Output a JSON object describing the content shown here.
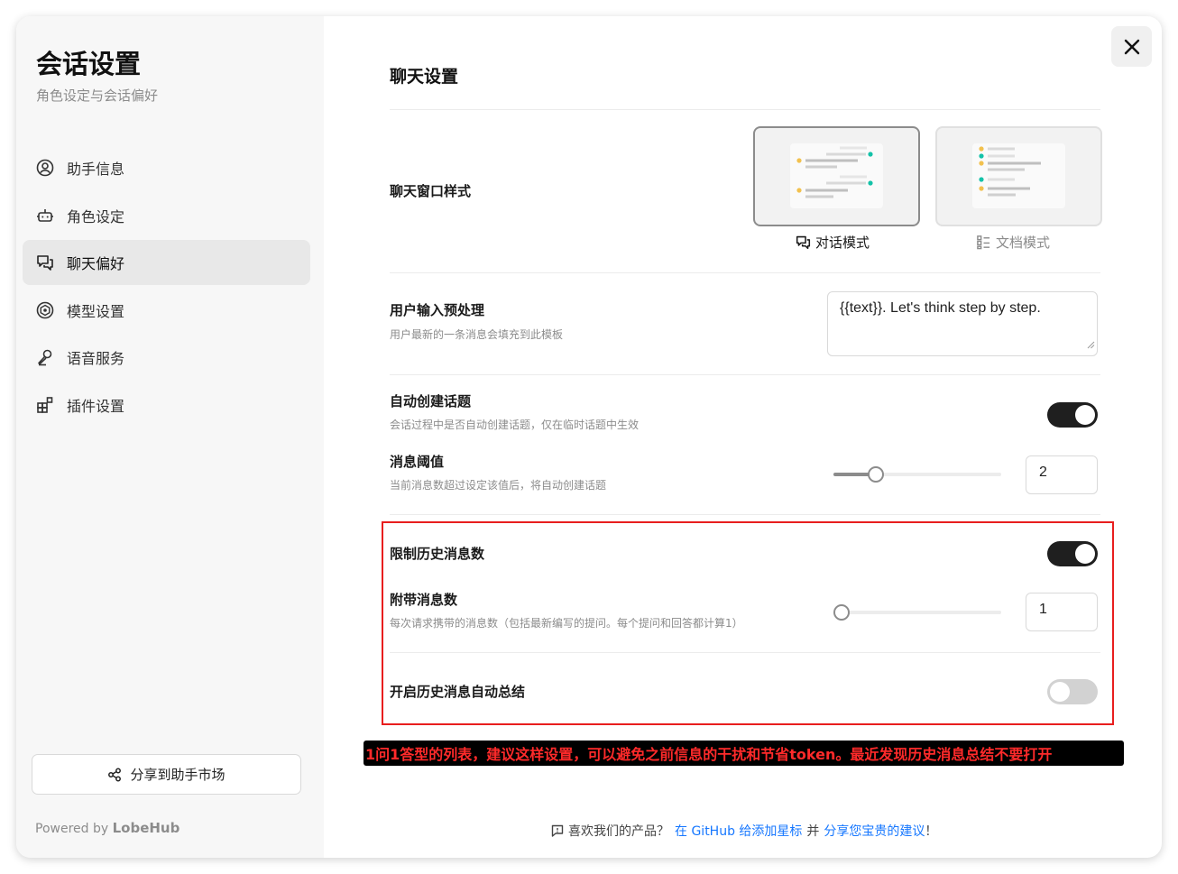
{
  "sidebar": {
    "title": "会话设置",
    "subtitle": "角色设定与会话偏好",
    "items": [
      {
        "label": "助手信息",
        "icon": "user-circle-icon"
      },
      {
        "label": "角色设定",
        "icon": "bot-icon"
      },
      {
        "label": "聊天偏好",
        "icon": "chat-bubbles-icon",
        "active": true
      },
      {
        "label": "模型设置",
        "icon": "model-icon"
      },
      {
        "label": "语音服务",
        "icon": "mic-icon"
      },
      {
        "label": "插件设置",
        "icon": "plugin-blocks-icon"
      }
    ],
    "share_label": "分享到助手市场",
    "powered_prefix": "Powered by",
    "powered_brand": "LobeHub"
  },
  "main": {
    "title": "聊天设置",
    "chat_style": {
      "label": "聊天窗口样式",
      "options": [
        {
          "label": "对话模式",
          "selected": true
        },
        {
          "label": "文档模式",
          "selected": false
        }
      ]
    },
    "input_template": {
      "label": "用户输入预处理",
      "desc": "用户最新的一条消息会填充到此模板",
      "value": "{{text}}. Let's think step by step."
    },
    "auto_topic": {
      "label": "自动创建话题",
      "desc": "会话过程中是否自动创建话题，仅在临时话题中生效",
      "enabled": true
    },
    "msg_threshold": {
      "label": "消息阈值",
      "desc": "当前消息数超过设定该值后，将自动创建话题",
      "value": "2",
      "slider_fraction": 0.25
    },
    "limit_history": {
      "label": "限制历史消息数",
      "enabled": true
    },
    "attached_msgs": {
      "label": "附带消息数",
      "desc": "每次请求携带的消息数（包括最新编写的提问。每个提问和回答都计算1）",
      "value": "1",
      "slider_fraction": 0.0
    },
    "history_summary": {
      "label": "开启历史消息自动总结",
      "enabled": false
    }
  },
  "annotation": "1问1答型的列表，建议这样设置，可以避免之前信息的干扰和节省token。最近发现历史消息总结不要打开",
  "footer": {
    "prefix": "喜欢我们的产品？",
    "link1": "在 GitHub 给添加星标",
    "mid": "并",
    "link2": "分享您宝贵的建议",
    "suffix": "！"
  },
  "colors": {
    "accent_dark": "#1f1f1f",
    "link": "#1677ff",
    "annotation_red": "#e81e1e"
  }
}
